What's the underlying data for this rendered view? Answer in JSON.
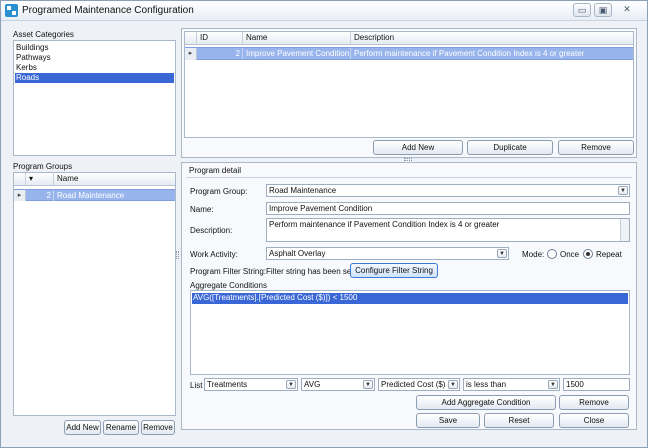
{
  "window": {
    "title": "Programed Maintenance Configuration",
    "minimize_glyph": "▭",
    "maximize_glyph": "▣",
    "close_glyph": "✕"
  },
  "asset_categories": {
    "label": "Asset Categories",
    "items": [
      "Buildings",
      "Pathways",
      "Kerbs",
      "Roads"
    ],
    "selected": "Roads"
  },
  "program_groups": {
    "label": "Program Groups",
    "columns": [
      "",
      "Name"
    ],
    "sort_glyph": "▾",
    "rows": [
      {
        "id": "2",
        "name": "Road Maintenance"
      }
    ],
    "buttons": {
      "add": "Add New",
      "rename": "Rename",
      "remove": "Remove"
    }
  },
  "programs": {
    "columns": [
      "ID",
      "Name",
      "Description"
    ],
    "rows": [
      {
        "id": "2",
        "name": "Improve Pavement Condition",
        "description": "Perform maintenance if Pavement Condition Index is 4 or greater"
      }
    ],
    "buttons": {
      "add": "Add New",
      "duplicate": "Duplicate",
      "remove": "Remove"
    }
  },
  "program_detail": {
    "label": "Program detail",
    "program_group_label": "Program Group:",
    "program_group_value": "Road Maintenance",
    "name_label": "Name:",
    "name_value": "Improve Pavement Condition",
    "description_label": "Description:",
    "description_value": "Perform maintenance if Pavement Condition Index is 4 or greater",
    "work_activity_label": "Work Activity:",
    "work_activity_value": "Asphalt Overlay",
    "mode_label": "Mode:",
    "mode_once": "Once",
    "mode_repeat": "Repeat",
    "mode_selected": "Repeat",
    "filter_label": "Program Filter String:",
    "filter_status": "Filter string has been set",
    "filter_button": "Configure Filter String",
    "aggregate_label": "Aggregate Conditions",
    "aggregate_rows": [
      "AVG([Treatments].[Predicted Cost ($)]) < 1500"
    ],
    "list_label": "List",
    "list_value": "Treatments",
    "function_value": "AVG",
    "field_value": "Predicted Cost ($)",
    "operator_value": "is less than",
    "threshold_value": "1500",
    "add_condition_button": "Add Aggregate Condition",
    "remove_condition_button": "Remove",
    "save_button": "Save",
    "reset_button": "Reset",
    "close_button": "Close"
  },
  "icons": {
    "app": "app-icon",
    "dropdown": "chevron-down-icon",
    "row_indicator": "row-pointer-icon",
    "splitter": "splitter-grip-icon"
  }
}
